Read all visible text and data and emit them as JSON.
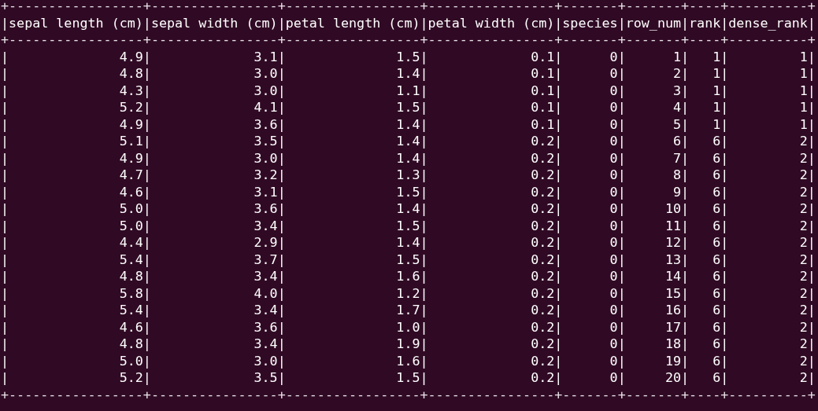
{
  "terminal": {
    "lines": [
      {
        "kind": "border",
        "text": "+-----------------+----------------+-----------------+----------------+-------+-------+----+----------+"
      },
      {
        "kind": "header",
        "text": "|sepal length (cm)|sepal width (cm)|petal length (cm)|petal width (cm)|species|row_num|rank|dense_rank|"
      },
      {
        "kind": "border",
        "text": "+-----------------+----------------+-----------------+----------------+-------+-------+----+----------+"
      },
      {
        "kind": "row",
        "text": "|              4.9|             3.1|              1.5|             0.1|      0|      1|   1|         1|"
      },
      {
        "kind": "row",
        "text": "|              4.8|             3.0|              1.4|             0.1|      0|      2|   1|         1|"
      },
      {
        "kind": "row",
        "text": "|              4.3|             3.0|              1.1|             0.1|      0|      3|   1|         1|"
      },
      {
        "kind": "row",
        "text": "|              5.2|             4.1|              1.5|             0.1|      0|      4|   1|         1|"
      },
      {
        "kind": "row",
        "text": "|              4.9|             3.6|              1.4|             0.1|      0|      5|   1|         1|"
      },
      {
        "kind": "row",
        "text": "|              5.1|             3.5|              1.4|             0.2|      0|      6|   6|         2|"
      },
      {
        "kind": "row",
        "text": "|              4.9|             3.0|              1.4|             0.2|      0|      7|   6|         2|"
      },
      {
        "kind": "row",
        "text": "|              4.7|             3.2|              1.3|             0.2|      0|      8|   6|         2|"
      },
      {
        "kind": "row",
        "text": "|              4.6|             3.1|              1.5|             0.2|      0|      9|   6|         2|"
      },
      {
        "kind": "row",
        "text": "|              5.0|             3.6|              1.4|             0.2|      0|     10|   6|         2|"
      },
      {
        "kind": "row",
        "text": "|              5.0|             3.4|              1.5|             0.2|      0|     11|   6|         2|"
      },
      {
        "kind": "row",
        "text": "|              4.4|             2.9|              1.4|             0.2|      0|     12|   6|         2|"
      },
      {
        "kind": "row",
        "text": "|              5.4|             3.7|              1.5|             0.2|      0|     13|   6|         2|"
      },
      {
        "kind": "row",
        "text": "|              4.8|             3.4|              1.6|             0.2|      0|     14|   6|         2|"
      },
      {
        "kind": "row",
        "text": "|              5.8|             4.0|              1.2|             0.2|      0|     15|   6|         2|"
      },
      {
        "kind": "row",
        "text": "|              5.4|             3.4|              1.7|             0.2|      0|     16|   6|         2|"
      },
      {
        "kind": "row",
        "text": "|              4.6|             3.6|              1.0|             0.2|      0|     17|   6|         2|"
      },
      {
        "kind": "row",
        "text": "|              4.8|             3.4|              1.9|             0.2|      0|     18|   6|         2|"
      },
      {
        "kind": "row",
        "text": "|              5.0|             3.0|              1.6|             0.2|      0|     19|   6|         2|"
      },
      {
        "kind": "row",
        "text": "|              5.2|             3.5|              1.5|             0.2|      0|     20|   6|         2|"
      },
      {
        "kind": "border",
        "text": "+-----------------+----------------+-----------------+----------------+-------+-------+----+----------+"
      }
    ]
  }
}
